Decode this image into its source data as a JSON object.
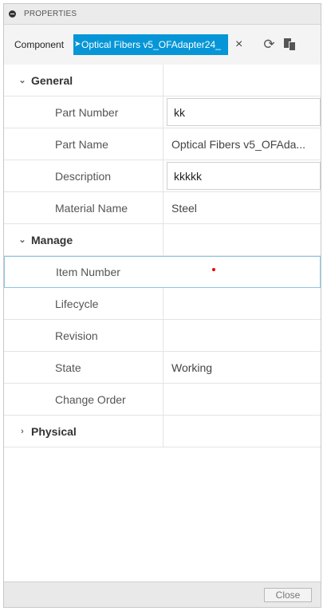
{
  "panel": {
    "title": "PROPERTIES"
  },
  "toolbar": {
    "component_label": "Component",
    "component_value": "Optical Fibers v5_OFAdapter24_",
    "clear": "×",
    "refresh": "⟳"
  },
  "sections": {
    "general": {
      "label": "General",
      "chevron": "⌄"
    },
    "manage": {
      "label": "Manage",
      "chevron": "⌄"
    },
    "physical": {
      "label": "Physical",
      "chevron": "›"
    }
  },
  "general": {
    "part_number": {
      "label": "Part Number",
      "value": "kk"
    },
    "part_name": {
      "label": "Part Name",
      "value": "Optical Fibers v5_OFAda..."
    },
    "description": {
      "label": "Description",
      "value": "kkkkk"
    },
    "material_name": {
      "label": "Material Name",
      "value": "Steel"
    }
  },
  "manage": {
    "item_number": {
      "label": "Item Number",
      "value": ""
    },
    "lifecycle": {
      "label": "Lifecycle",
      "value": ""
    },
    "revision": {
      "label": "Revision",
      "value": ""
    },
    "state": {
      "label": "State",
      "value": "Working"
    },
    "change_order": {
      "label": "Change Order",
      "value": ""
    }
  },
  "footer": {
    "close_label": "Close"
  }
}
